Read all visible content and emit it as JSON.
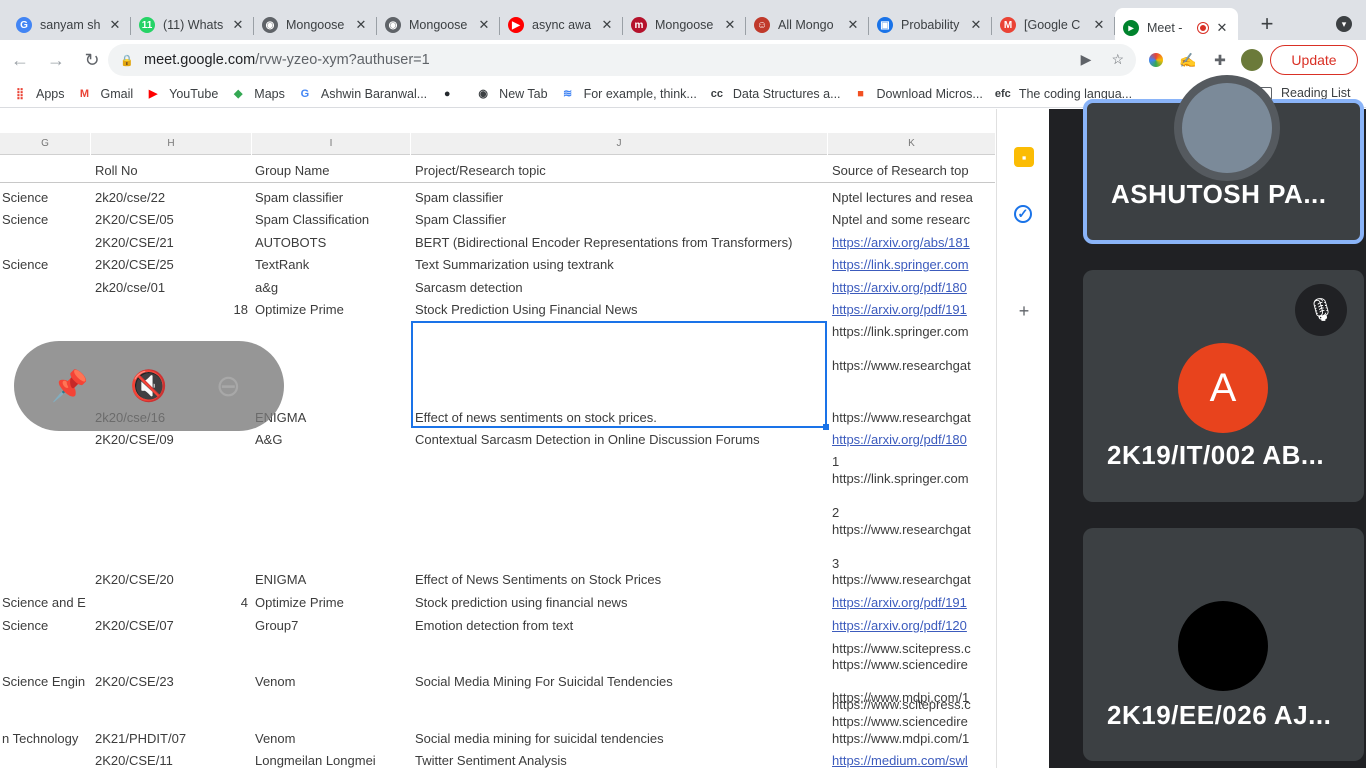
{
  "browser": {
    "tabs": [
      {
        "title": "sanyam sh",
        "icon": "google-icon",
        "color": "#4285f4",
        "glyph": "G",
        "active": false
      },
      {
        "title": "(11) Whats",
        "icon": "whatsapp-icon",
        "color": "#25d366",
        "glyph": "11",
        "active": false
      },
      {
        "title": "Mongoose",
        "icon": "globe-icon",
        "color": "#5f6368",
        "glyph": "◉",
        "active": false
      },
      {
        "title": "Mongoose",
        "icon": "globe-icon",
        "color": "#5f6368",
        "glyph": "◉",
        "active": false
      },
      {
        "title": "async awa",
        "icon": "youtube-icon",
        "color": "#ff0000",
        "glyph": "▶",
        "active": false
      },
      {
        "title": "Mongoose",
        "icon": "medium-icon",
        "color": "#b5122c",
        "glyph": "m",
        "active": false
      },
      {
        "title": "All Mongo",
        "icon": "profile-icon",
        "color": "#c0392b",
        "glyph": "☺",
        "active": false
      },
      {
        "title": "Probability",
        "icon": "classroom-icon",
        "color": "#1a73e8",
        "glyph": "▣",
        "active": false
      },
      {
        "title": "[Google C",
        "icon": "gmail-icon",
        "color": "#ea4335",
        "glyph": "M",
        "active": false
      },
      {
        "title": "Meet -",
        "icon": "meet-icon",
        "color": "#00832d",
        "glyph": "▸",
        "active": true
      }
    ],
    "url_host": "meet.google.com",
    "url_path": "/rvw-yzeo-xym?authuser=1",
    "update_label": "Update",
    "bookmarks": [
      {
        "label": "Apps",
        "icon": "apps-grid-icon"
      },
      {
        "label": "Gmail",
        "icon": "gmail-icon"
      },
      {
        "label": "YouTube",
        "icon": "youtube-icon"
      },
      {
        "label": "Maps",
        "icon": "maps-icon"
      },
      {
        "label": "Ashwin Baranwal...",
        "icon": "google-icon"
      },
      {
        "label": "",
        "icon": "github-icon"
      },
      {
        "label": "New Tab",
        "icon": "globe-icon"
      },
      {
        "label": "For example, think...",
        "icon": "site-icon"
      },
      {
        "label": "Data Structures a...",
        "icon": "cc-icon"
      },
      {
        "label": "Download Micros...",
        "icon": "microsoft-icon"
      },
      {
        "label": "The coding langua...",
        "icon": "efc-icon"
      }
    ],
    "bookmarks_more": "»",
    "reading_list": "Reading List"
  },
  "sheet": {
    "column_letters": [
      "G",
      "H",
      "I",
      "J",
      "K"
    ],
    "headers": {
      "dept": "",
      "roll": "Roll No",
      "group": "Group Name",
      "topic": "Project/Research topic",
      "source": "Source of Research top"
    },
    "rows": [
      {
        "dept": "Science",
        "roll": "2k20/cse/22",
        "group": "Spam classifier",
        "num": "",
        "topic": "Spam classifier",
        "source": [
          "Nptel lectures and resea"
        ],
        "link": false
      },
      {
        "dept": "Science",
        "roll": "2K20/CSE/05",
        "group": "Spam Classification",
        "num": "",
        "topic": "Spam Classifier",
        "source": [
          "Nptel and some researc"
        ],
        "link": false
      },
      {
        "dept": "",
        "roll": "2K20/CSE/21",
        "group": "AUTOBOTS",
        "num": "",
        "topic": "BERT (Bidirectional Encoder Representations from Transformers)",
        "source": [
          "https://arxiv.org/abs/181"
        ],
        "link": true
      },
      {
        "dept": "Science",
        "roll": "2K20/CSE/25",
        "group": "TextRank",
        "num": "",
        "topic": "Text Summarization using textrank",
        "source": [
          "https://link.springer.com"
        ],
        "link": true
      },
      {
        "dept": "",
        "roll": "2k20/cse/01",
        "group": "a&g",
        "num": "",
        "topic": "Sarcasm detection",
        "source": [
          "https://arxiv.org/pdf/180"
        ],
        "link": true
      },
      {
        "dept": "",
        "roll": "",
        "group": "Optimize Prime",
        "num": "18",
        "topic": "Stock Prediction Using Financial News",
        "source": [
          "https://arxiv.org/pdf/191"
        ],
        "link": true
      },
      {
        "dept": "",
        "roll": "2k20/cse/16",
        "group": "ENIGMA",
        "num": "",
        "topic": "Effect of news sentiments on stock prices.",
        "source": [
          "https://link.springer.com",
          "",
          "https://www.researchgat",
          "",
          "",
          "https://www.researchgat"
        ],
        "link": false
      },
      {
        "dept": "",
        "roll": "2K20/CSE/09",
        "group": "A&G",
        "num": "",
        "topic": "Contextual Sarcasm Detection in Online Discussion Forums",
        "source": [
          "https://arxiv.org/pdf/180",
          "1",
          "https://link.springer.com",
          "",
          "2",
          "https://www.researchgat",
          "",
          "3"
        ],
        "link": false
      },
      {
        "dept": "",
        "roll": "2K20/CSE/20",
        "group": "ENIGMA",
        "num": "",
        "topic": "Effect of News Sentiments on Stock Prices",
        "source": [
          "https://www.researchgat"
        ],
        "link": false
      },
      {
        "dept": "Science and E",
        "roll": "",
        "group": "Optimize Prime",
        "num": "4",
        "topic": "Stock prediction using financial news",
        "source": [
          "https://arxiv.org/pdf/191"
        ],
        "link": true
      },
      {
        "dept": "Science",
        "roll": "2K20/CSE/07",
        "group": "Group7",
        "num": "",
        "topic": "Emotion detection from text",
        "source": [
          "https://arxiv.org/pdf/120"
        ],
        "link": true
      },
      {
        "dept": "Science Engin",
        "roll": "2K20/CSE/23",
        "group": "Venom",
        "num": "",
        "topic": "Social Media Mining For Suicidal Tendencies",
        "source": [
          "https://www.scitepress.c",
          "https://www.sciencedire",
          "",
          "https://www.mdpi.com/1"
        ],
        "link": false
      },
      {
        "dept": "n Technology",
        "roll": "2K21/PHDIT/07",
        "group": "Venom",
        "num": "",
        "topic": "Social media mining for suicidal tendencies",
        "source": [
          "https://www.scitepress.c",
          "https://www.sciencedire",
          "https://www.mdpi.com/1"
        ],
        "link": false
      },
      {
        "dept": "",
        "roll": "2K20/CSE/11",
        "group": "Longmeilan Longmei",
        "num": "",
        "topic": "Twitter Sentiment Analysis",
        "source": [
          "https://medium.com/swl"
        ],
        "link": true
      }
    ]
  },
  "presenter_controls": [
    {
      "name": "unpin-icon",
      "glyph": "📌"
    },
    {
      "name": "mute-audio-icon",
      "glyph": "🔇"
    },
    {
      "name": "minimize-icon",
      "glyph": "⊖"
    }
  ],
  "participants": [
    {
      "name": "ASHUTOSH PA...",
      "initial": "",
      "avatar_color": "#7b8a99",
      "speaking": true,
      "muted": false
    },
    {
      "name": "2K19/IT/002 AB...",
      "initial": "A",
      "avatar_color": "#e8431d",
      "speaking": false,
      "muted": true
    },
    {
      "name": "2K19/EE/026 AJ...",
      "initial": "",
      "avatar_color": "#000000",
      "speaking": false,
      "muted": false
    }
  ]
}
